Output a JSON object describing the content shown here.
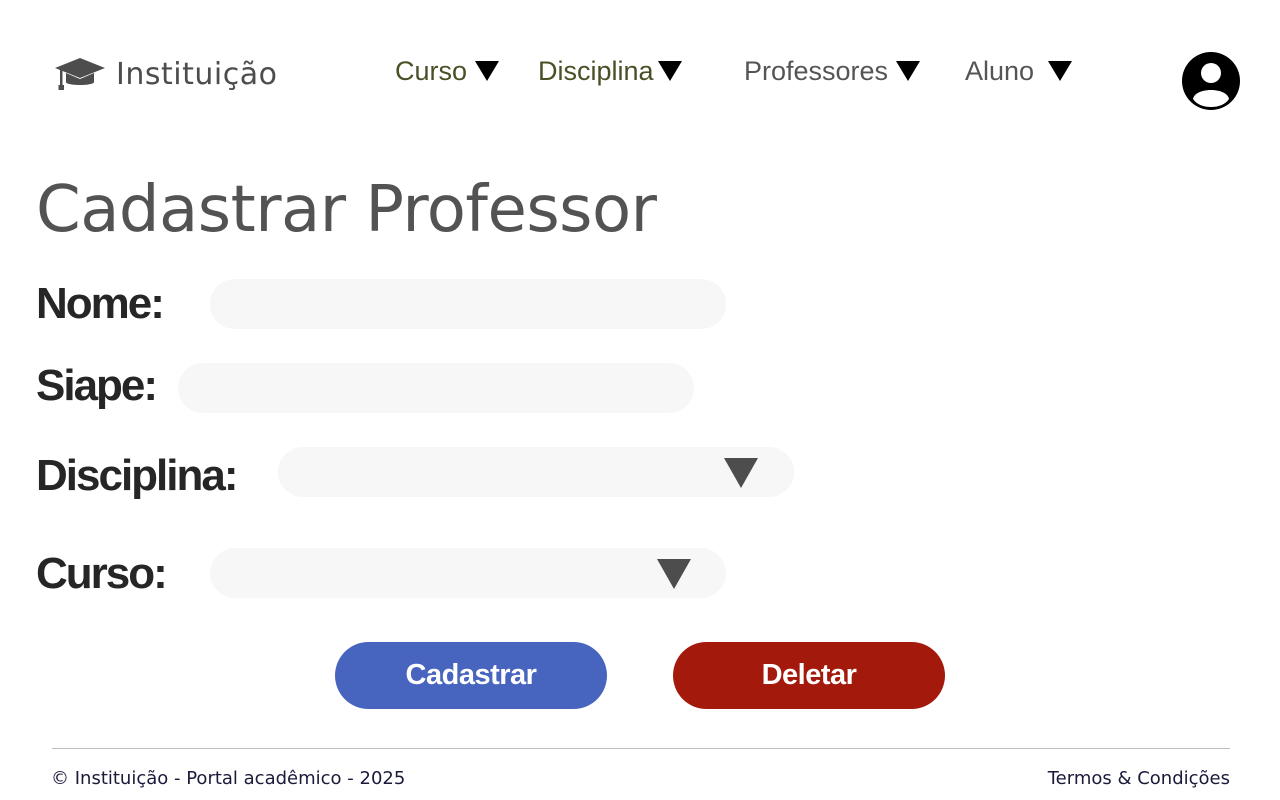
{
  "header": {
    "brand_name": "Instituição",
    "brand_icon": "graduation-cap-icon",
    "nav": [
      {
        "label": "Curso",
        "color": "#4a5026"
      },
      {
        "label": "Disciplina",
        "color": "#4a5026"
      },
      {
        "label": "Professores",
        "color": "#555555"
      },
      {
        "label": "Aluno",
        "color": "#555555"
      }
    ],
    "avatar_icon": "user-circle-icon"
  },
  "main": {
    "title": "Cadastrar Professor",
    "form": {
      "nome_label": "Nome:",
      "nome_value": "",
      "siape_label": "Siape:",
      "siape_value": "",
      "disciplina_label": "Disciplina:",
      "disciplina_value": "",
      "curso_label": "Curso:",
      "curso_value": ""
    },
    "buttons": {
      "cadastrar_label": "Cadastrar",
      "deletar_label": "Deletar"
    }
  },
  "footer": {
    "copyright": "© Instituição - Portal acadêmico - 2025",
    "terms_link": "Termos & Condições"
  },
  "colors": {
    "primary_button": "#4764bf",
    "danger_button": "#a3190b",
    "field_background": "#f7f7f7"
  }
}
